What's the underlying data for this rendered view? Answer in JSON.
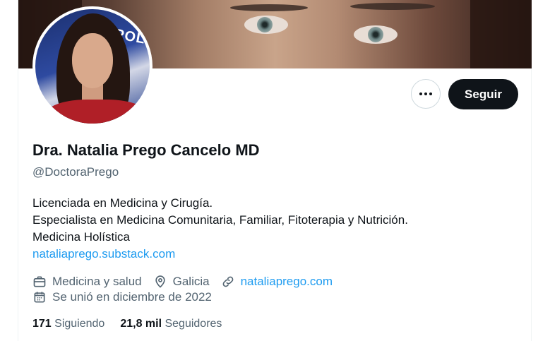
{
  "profile": {
    "name": "Dra. Natalia Prego Cancelo MD",
    "handle": "@DoctoraPrego",
    "bio_lines": [
      "Licenciada en Medicina y Cirugía.",
      "Especialista en Medicina Comunitaria, Familiar, Fitoterapia y Nutrición.",
      "Medicina Holística"
    ],
    "bio_link": "nataliaprego.substack.com",
    "category": "Medicina y salud",
    "location": "Galicia",
    "website": "nataliaprego.com",
    "joined": "Se unió en diciembre de 2022",
    "avatar_sign_text": "POL"
  },
  "actions": {
    "follow_label": "Seguir",
    "more_icon": "more-horizontal-icon"
  },
  "stats": {
    "following_count": "171",
    "following_label": "Siguiendo",
    "followers_count": "21,8 mil",
    "followers_label": "Seguidores"
  },
  "icons": {
    "category": "briefcase-icon",
    "location": "location-pin-icon",
    "website": "link-icon",
    "joined": "calendar-icon"
  },
  "colors": {
    "link": "#1d9bf0",
    "secondary_text": "#536471",
    "primary_text": "#0f1419",
    "follow_button_bg": "#0f1419",
    "border": "#cfd9de"
  }
}
